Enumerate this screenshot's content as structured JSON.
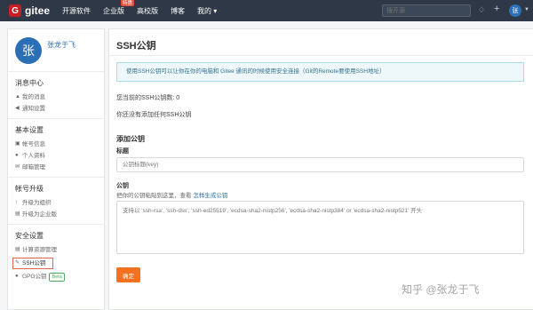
{
  "logo": {
    "mark": "G",
    "text": "gitee"
  },
  "nav": [
    {
      "label": "开源软件"
    },
    {
      "label": "企业版",
      "badge": "特惠"
    },
    {
      "label": "高校版"
    },
    {
      "label": "博客"
    },
    {
      "label": "我的 ▾"
    }
  ],
  "search": {
    "placeholder": "搜开源"
  },
  "top_icons": {
    "bell": "bell-icon",
    "plus": "plus-icon"
  },
  "user": {
    "initial": "张",
    "name": "张龙于飞"
  },
  "sidebar": {
    "groups": [
      {
        "title": "消息中心",
        "items": [
          {
            "icon": "▲",
            "label": "我的消息"
          },
          {
            "icon": "◀",
            "label": "通知设置"
          }
        ]
      },
      {
        "title": "基本设置",
        "items": [
          {
            "icon": "▣",
            "label": "帐号信息"
          },
          {
            "icon": "●",
            "label": "个人资料"
          },
          {
            "icon": "✉",
            "label": "邮箱管理"
          }
        ]
      },
      {
        "title": "帐号升级",
        "items": [
          {
            "icon": "↑",
            "label": "升级为组织"
          },
          {
            "icon": "▤",
            "label": "升级为企业版"
          }
        ]
      },
      {
        "title": "安全设置",
        "items": [
          {
            "icon": "▤",
            "label": "计算资源管理"
          },
          {
            "icon": "✎",
            "label": "SSH公钥",
            "active": true
          },
          {
            "icon": "●",
            "label": "GPG公钥",
            "badge": "Beta"
          }
        ]
      }
    ]
  },
  "main": {
    "title": "SSH公钥",
    "info": "使用SSH公钥可以让你在你的电脑和 Gitee 通讯的时候使用安全连接（Git的Remote要使用SSH地址）",
    "count_text": "您当前的SSH公钥数: 0",
    "empty_text": "你还没有添加任何SSH公钥",
    "add_title": "添加公钥",
    "title_label": "标题",
    "title_placeholder": "公钥标题(key)",
    "key_label": "公钥",
    "key_hint": "把你的公钥粘贴到这里，查看",
    "key_hint_link": "怎样生成公钥",
    "key_placeholder": "支持以 'ssh-rsa', 'ssh-dss', 'ssh-ed25519', 'ecdsa-sha2-nistp256', 'ecdsa-sha2-nistp384' or 'ecdsa-sha2-nistp521' 开头",
    "confirm_label": "确定"
  },
  "watermark": "知乎 @张龙于飞",
  "colors": {
    "topbar": "#2e3846",
    "accent": "#f4711f",
    "brand": "#c71d23",
    "link": "#2b6fb6"
  }
}
